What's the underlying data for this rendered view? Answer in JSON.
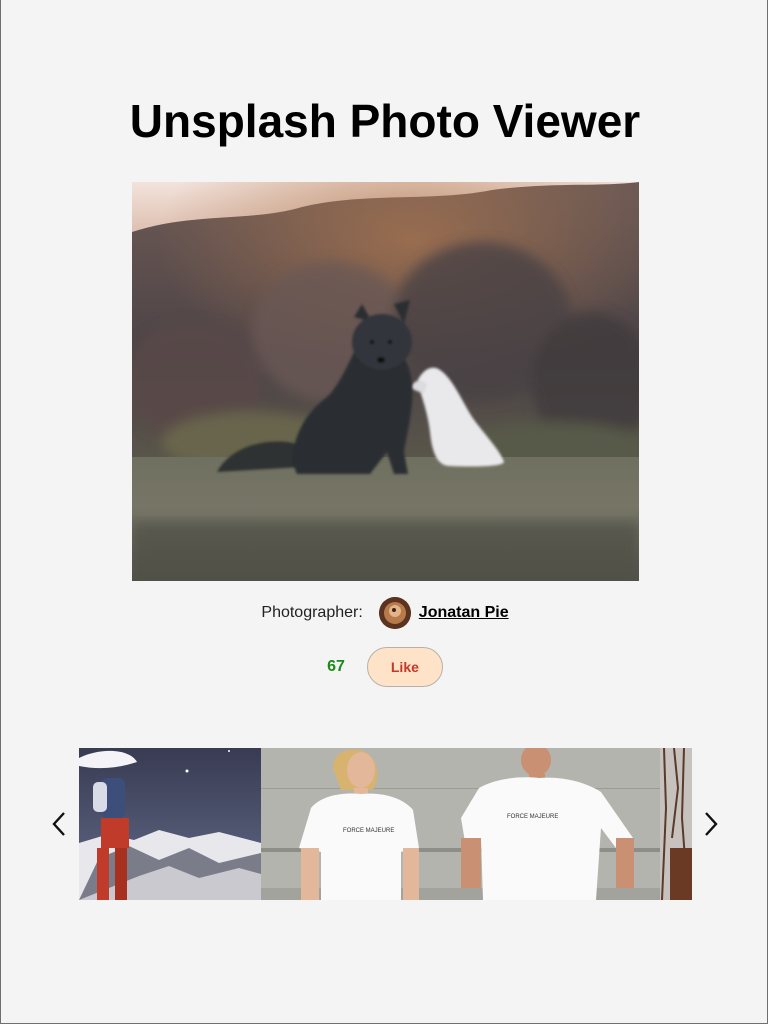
{
  "page": {
    "title": "Unsplash Photo Viewer"
  },
  "photo": {
    "alt": "Dark arctic fox sitting on grass beside a white fox"
  },
  "photographer": {
    "label": "Photographer:",
    "name": "Jonatan Pie",
    "avatar": "photographer-avatar"
  },
  "likes": {
    "count": "67",
    "button_label": "Like",
    "count_color": "#1b8a1b",
    "button_bg": "#ffe3c8",
    "button_text_color": "#c0392b"
  },
  "carousel": {
    "prev_icon": "chevron-left-icon",
    "next_icon": "chevron-right-icon",
    "thumbnails": [
      {
        "alt": "Person in red pants on a snowy mountain at night"
      },
      {
        "alt": "Two people wearing white Force Majeure t-shirts"
      },
      {
        "alt": "Partially visible autumn tree photo"
      }
    ]
  }
}
